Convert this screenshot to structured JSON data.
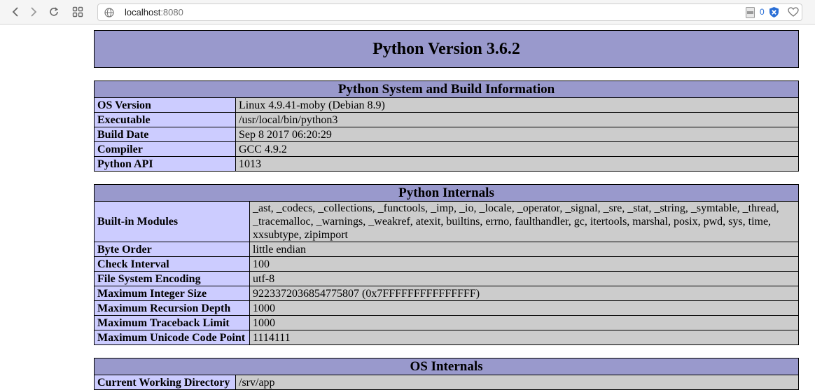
{
  "browser": {
    "url_host": "localhost",
    "url_port": ":8080",
    "extension_count": "0"
  },
  "page": {
    "title": "Python Version 3.6.2",
    "sections": [
      {
        "heading": "Python System and Build Information",
        "rows": [
          {
            "key": "OS Version",
            "value": "Linux 4.9.41-moby (Debian 8.9)"
          },
          {
            "key": "Executable",
            "value": "/usr/local/bin/python3"
          },
          {
            "key": "Build Date",
            "value": "Sep 8 2017 06:20:29"
          },
          {
            "key": "Compiler",
            "value": "GCC 4.9.2"
          },
          {
            "key": "Python API",
            "value": "1013"
          }
        ]
      },
      {
        "heading": "Python Internals",
        "rows": [
          {
            "key": "Built-in Modules",
            "value": "_ast, _codecs, _collections, _functools, _imp, _io, _locale, _operator, _signal, _sre, _stat, _string, _symtable, _thread, _tracemalloc, _warnings, _weakref, atexit, builtins, errno, faulthandler, gc, itertools, marshal, posix, pwd, sys, time, xxsubtype, zipimport"
          },
          {
            "key": "Byte Order",
            "value": "little endian"
          },
          {
            "key": "Check Interval",
            "value": "100"
          },
          {
            "key": "File System Encoding",
            "value": "utf-8"
          },
          {
            "key": "Maximum Integer Size",
            "value": "9223372036854775807 (0x7FFFFFFFFFFFFFFF)"
          },
          {
            "key": "Maximum Recursion Depth",
            "value": "1000"
          },
          {
            "key": "Maximum Traceback Limit",
            "value": "1000"
          },
          {
            "key": "Maximum Unicode Code Point",
            "value": "1114111"
          }
        ]
      },
      {
        "heading": "OS Internals",
        "rows": [
          {
            "key": "Current Working Directory",
            "value": "/srv/app"
          }
        ]
      }
    ]
  }
}
